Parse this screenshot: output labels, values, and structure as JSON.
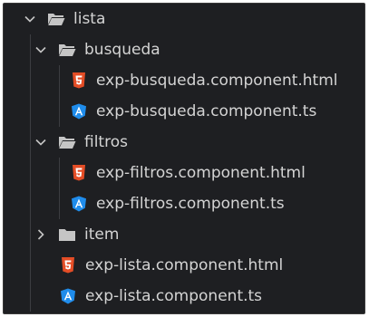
{
  "explorer": {
    "colors": {
      "background": "#1e1f22",
      "text": "#d4d4d4",
      "chevron": "#c5c5c5",
      "folder": "#c5c5c5",
      "html_icon": "#e44d26",
      "angular_icon": "#1f8ceb"
    },
    "nodes": [
      {
        "label": "lista",
        "type": "folder",
        "expanded": true,
        "icon": "folder-open-icon"
      },
      {
        "label": "busqueda",
        "type": "folder",
        "expanded": true,
        "icon": "folder-open-icon"
      },
      {
        "label": "exp-busqueda.component.html",
        "type": "file",
        "icon": "html5-icon"
      },
      {
        "label": "exp-busqueda.component.ts",
        "type": "file",
        "icon": "angular-icon"
      },
      {
        "label": "filtros",
        "type": "folder",
        "expanded": true,
        "icon": "folder-open-icon"
      },
      {
        "label": "exp-filtros.component.html",
        "type": "file",
        "icon": "html5-icon"
      },
      {
        "label": "exp-filtros.component.ts",
        "type": "file",
        "icon": "angular-icon"
      },
      {
        "label": "item",
        "type": "folder",
        "expanded": false,
        "icon": "folder-icon"
      },
      {
        "label": "exp-lista.component.html",
        "type": "file",
        "icon": "html5-icon"
      },
      {
        "label": "exp-lista.component.ts",
        "type": "file",
        "icon": "angular-icon"
      }
    ]
  }
}
